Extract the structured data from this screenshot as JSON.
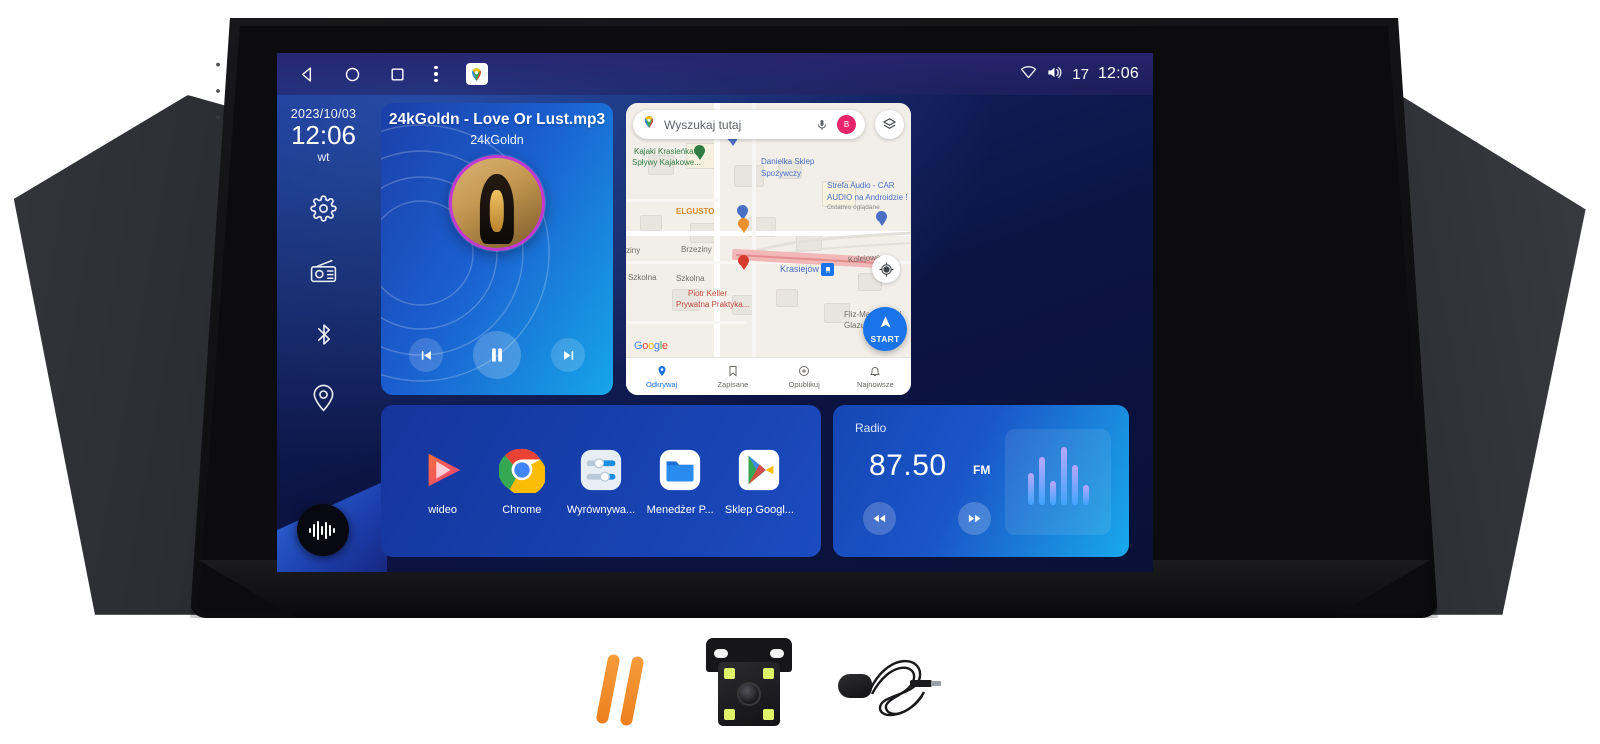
{
  "status_bar": {
    "back_icon": "back-triangle-icon",
    "home_icon": "home-circle-icon",
    "recents_icon": "recents-square-icon",
    "overflow_icon": "three-dot-menu-icon",
    "maps_shortcut_icon": "google-maps-icon",
    "wifi_icon": "wifi-icon",
    "volume_icon": "volume-icon",
    "volume_level": "17",
    "clock": "12:06"
  },
  "sidebar": {
    "date": "2023/10/03",
    "clock": "12:06",
    "weekday": "wt",
    "items": [
      {
        "name": "settings",
        "icon": "gear-icon"
      },
      {
        "name": "radio",
        "icon": "radio-icon"
      },
      {
        "name": "bluetooth",
        "icon": "bluetooth-icon"
      },
      {
        "name": "navigation",
        "icon": "location-pin-icon"
      }
    ],
    "voice_button_icon": "audio-waveform-icon"
  },
  "music": {
    "title": "24kGoldn - Love Or Lust.mp3",
    "artist": "24kGoldn",
    "prev_icon": "previous-track-icon",
    "play_pause_icon": "pause-icon",
    "next_icon": "next-track-icon"
  },
  "map": {
    "search_placeholder": "Wyszukaj tutaj",
    "search_value": "",
    "maps_pin_icon": "google-maps-pin-icon",
    "mic_icon": "microphone-icon",
    "avatar_initial": "B",
    "layers_icon": "layers-icon",
    "locate_icon": "my-location-icon",
    "start_button_label": "START",
    "start_button_icon": "navigation-arrow-icon",
    "watermark": "Google",
    "labels": [
      {
        "text": "Kajaki Krasieńka -",
        "color": "green"
      },
      {
        "text": "Spływy Kajakowe...",
        "color": "green"
      },
      {
        "text": "Danielka Sklep",
        "color": "blue"
      },
      {
        "text": "Spożywczy",
        "color": "blue"
      },
      {
        "text": "ELGUSTO",
        "color": "orange"
      },
      {
        "text": "Strefa Audio - CAR",
        "color": "blue"
      },
      {
        "text": "AUDIO na Androidzie !",
        "color": "blue"
      },
      {
        "text": "Ostatnio oglądane",
        "color": "grey"
      },
      {
        "text": "Brzeziny",
        "color": "grey"
      },
      {
        "text": "ziny",
        "color": "grey"
      },
      {
        "text": "Szkolna",
        "color": "grey"
      },
      {
        "text": "Szkolna",
        "color": "grey"
      },
      {
        "text": "Kolejowa",
        "color": "grey"
      },
      {
        "text": "Krasiejów",
        "color": "blue"
      },
      {
        "text": "Piotr Keller",
        "color": "red"
      },
      {
        "text": "Prywatna Praktyka...",
        "color": "red"
      },
      {
        "text": "Fliz-Mark Usługi",
        "color": "grey"
      },
      {
        "text": "Glazurnicze",
        "color": "grey"
      }
    ],
    "bottom_nav": [
      {
        "label": "Odkrywaj",
        "icon": "explore-pin-icon",
        "active": true
      },
      {
        "label": "Zapisane",
        "icon": "bookmark-icon",
        "active": false
      },
      {
        "label": "Opublikuj",
        "icon": "contribute-plus-icon",
        "active": false
      },
      {
        "label": "Najnowsze",
        "icon": "bell-icon",
        "active": false
      }
    ]
  },
  "apps": [
    {
      "label": "wideo",
      "icon": "video-play-icon"
    },
    {
      "label": "Chrome",
      "icon": "chrome-icon"
    },
    {
      "label": "Wyrównywa...",
      "icon": "equalizer-settings-icon"
    },
    {
      "label": "Menedżer P...",
      "icon": "file-manager-folder-icon"
    },
    {
      "label": "Sklep Googl...",
      "icon": "google-play-store-icon"
    }
  ],
  "radio": {
    "title": "Radio",
    "frequency": "87.50",
    "band": "FM",
    "prev_icon": "rewind-icon",
    "next_icon": "fast-forward-icon",
    "visual_icon": "audio-equalizer-icon"
  },
  "accessories": [
    {
      "name": "pry-tools",
      "icon": "pry-tool-icon"
    },
    {
      "name": "rear-camera",
      "icon": "rear-camera-icon"
    },
    {
      "name": "external-microphone",
      "icon": "external-microphone-icon"
    }
  ],
  "colors": {
    "screen_bg": "#0c1444",
    "card_blue": "#1b4cc0",
    "accent_cyan": "#19a9ea",
    "maps_blue": "#1a73e8",
    "avatar_pink": "#e8246c"
  }
}
